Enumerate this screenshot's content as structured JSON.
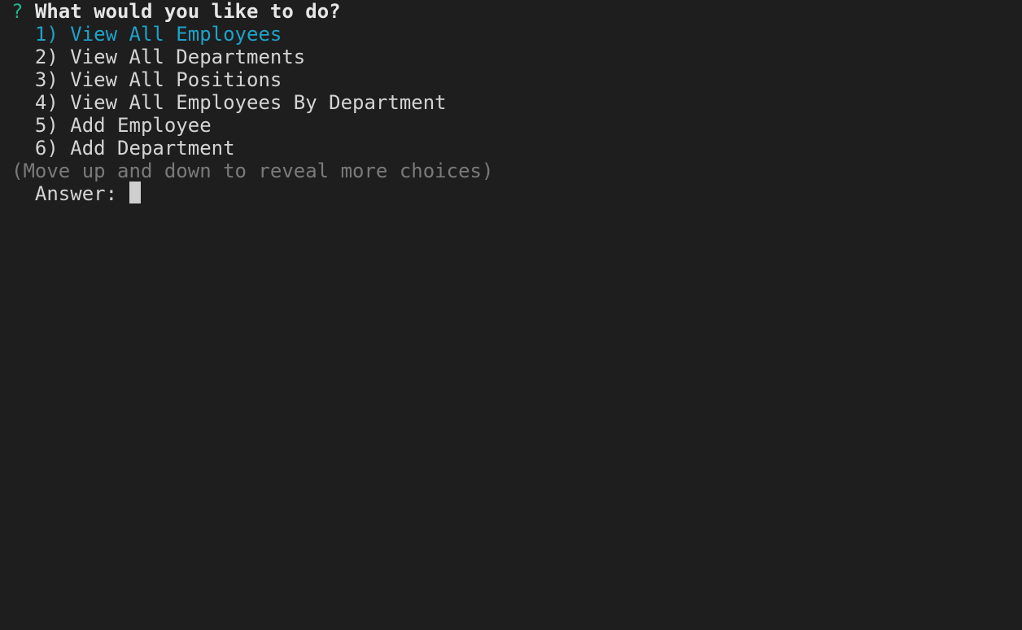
{
  "prompt": {
    "mark": "?",
    "question": "What would you like to do?"
  },
  "choices": [
    {
      "label": "1) View All Employees",
      "selected": true
    },
    {
      "label": "2) View All Departments",
      "selected": false
    },
    {
      "label": "3) View All Positions",
      "selected": false
    },
    {
      "label": "4) View All Employees By Department",
      "selected": false
    },
    {
      "label": "5) Add Employee",
      "selected": false
    },
    {
      "label": "6) Add Department",
      "selected": false
    }
  ],
  "hint": "(Move up and down to reveal more choices)",
  "answer": {
    "label": "Answer:",
    "value": ""
  },
  "colors": {
    "background": "#1e1e1e",
    "prompt_mark": "#23b38a",
    "selected": "#1fa2c8",
    "text": "#d4d4d4",
    "hint": "#7a7a7a"
  }
}
